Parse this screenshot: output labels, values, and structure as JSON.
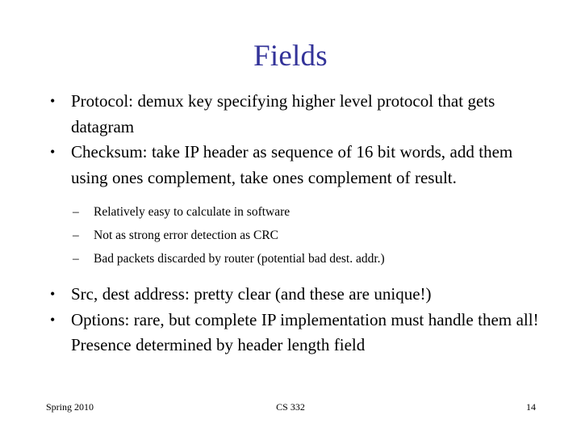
{
  "slide": {
    "title": "Fields",
    "title_color": "#333399",
    "background_color": "#ffffff",
    "text_color": "#000000",
    "bullet_marker": "•",
    "sub_bullet_marker": "–",
    "bullets": [
      {
        "level": 1,
        "text": "Protocol: demux key specifying higher level protocol that gets datagram"
      },
      {
        "level": 1,
        "text": "Checksum: take IP header as sequence of 16 bit words, add them using ones complement, take ones complement of result."
      },
      {
        "level": 2,
        "text": "Relatively easy to calculate in software"
      },
      {
        "level": 2,
        "text": "Not as strong error detection as CRC"
      },
      {
        "level": 2,
        "text": "Bad packets discarded by router (potential bad dest. addr.)"
      },
      {
        "level": 1,
        "text": "Src, dest address: pretty clear (and these are unique!)"
      },
      {
        "level": 1,
        "text": "Options: rare, but complete IP implementation must handle them all!  Presence determined by header length field"
      }
    ]
  },
  "footer": {
    "left": "Spring 2010",
    "center": "CS 332",
    "right": "14"
  }
}
